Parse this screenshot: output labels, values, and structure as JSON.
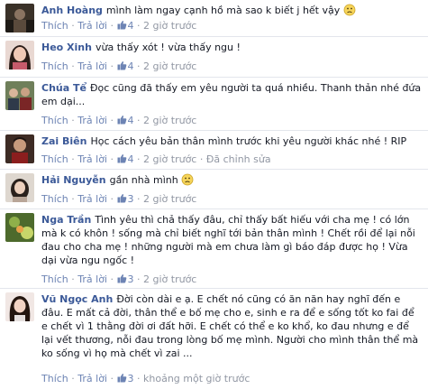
{
  "actions": {
    "like": "Thích",
    "reply": "Trả lời",
    "sep": "·"
  },
  "comments": [
    {
      "author": "Anh Hoàng",
      "text": "mình làm ngay cạnh hồ mà sao k biết j hết vậy",
      "likes": "4",
      "time": "2 giờ trước",
      "extra": "",
      "emoji": "frown-emoji"
    },
    {
      "author": "Heo Xinh",
      "text": "vừa thấy xót ! vừa thấy ngu !",
      "likes": "4",
      "time": "2 giờ trước",
      "extra": "",
      "emoji": ""
    },
    {
      "author": "Chúa Tể",
      "text": "Đọc cũng đã thấy em yêu người ta quá nhiều. Thanh thản nhé đứa em dại...",
      "likes": "4",
      "time": "2 giờ trước",
      "extra": "",
      "emoji": ""
    },
    {
      "author": "Zai Biên",
      "text": "Học cách yêu bản thân mình trước khi yêu người khác nhé ! RIP",
      "likes": "4",
      "time": "2 giờ trước",
      "extra": "Đã chỉnh sửa",
      "emoji": ""
    },
    {
      "author": "Hải Nguyễn",
      "text": "gần nhà mình",
      "likes": "3",
      "time": "2 giờ trước",
      "extra": "",
      "emoji": "frown-emoji"
    },
    {
      "author": "Nga Trần",
      "text": "Tình yêu thì chả thấy đâu, chỉ thấy bất hiếu với cha mẹ ! có lớn mà k có khôn ! sống mà chỉ biết nghĩ tới bản thân mình ! Chết rồi để lại nỗi đau cho cha mẹ ! những người mà em chưa làm gì báo đáp được họ ! Vừa dại vừa ngu ngốc !",
      "likes": "3",
      "time": "2 giờ trước",
      "extra": "",
      "emoji": ""
    },
    {
      "author": "Vũ Ngọc Anh",
      "text": "Đời còn dài e ạ. E chết nó cũng có ăn năn hay nghĩ đến e đâu. E mất cả đời, thân thể e bố mẹ cho e, sinh e ra để e sống tốt ko fai để e chết vì 1 thằng đời ơi đất hỡi. E chết có thể e ko khổ, ko đau nhưng e để lại vết thương, nỗi đau trong lòng bố mẹ mình. Người cho mình thân thể mà ko sống vì họ mà chết vì zai ...",
      "likes": "3",
      "time": "khoảng một giờ trước",
      "extra": "",
      "emoji": ""
    }
  ]
}
